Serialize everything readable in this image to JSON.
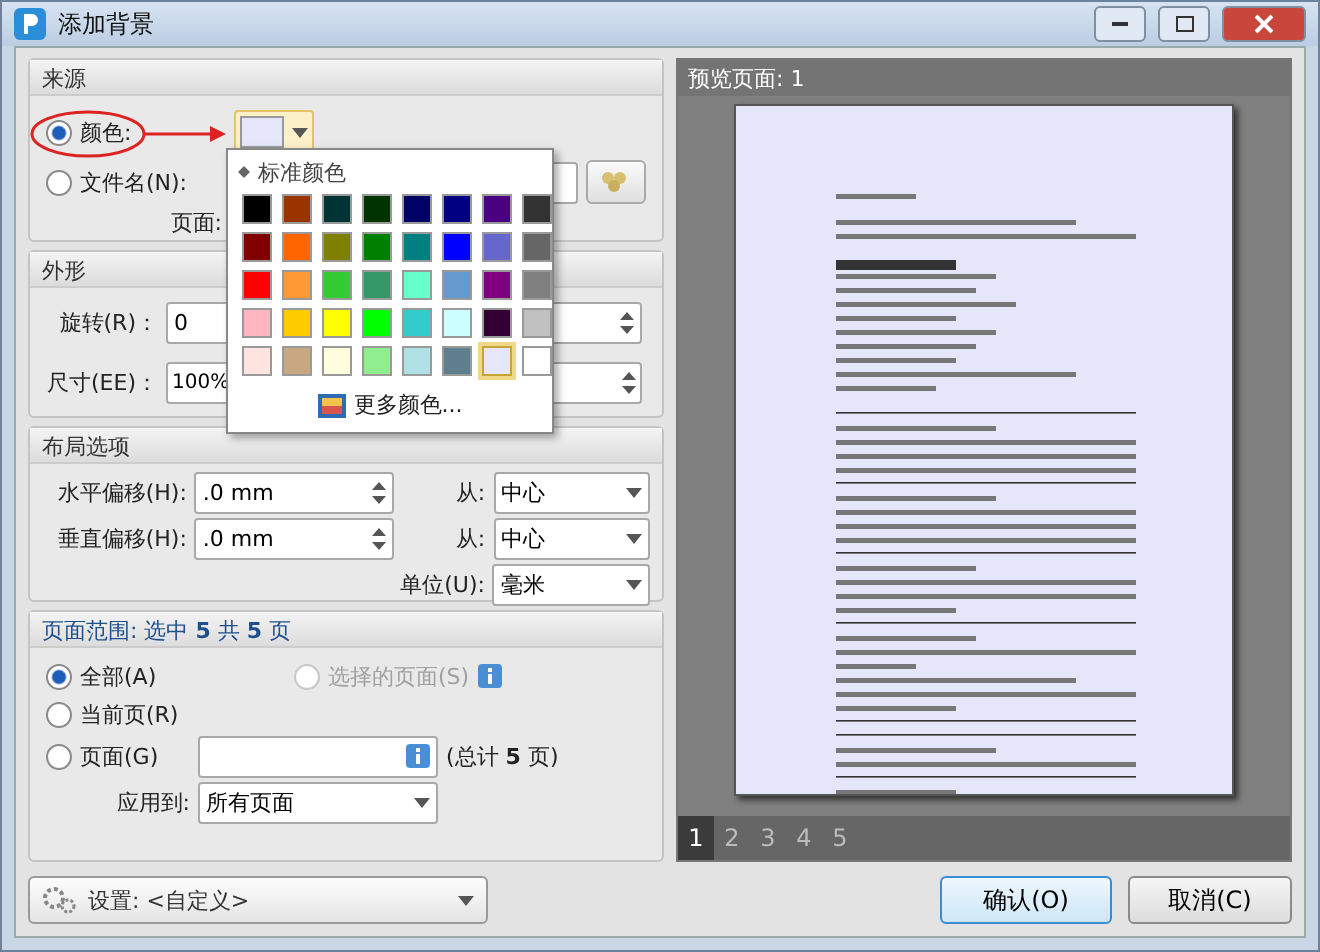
{
  "window": {
    "title": "添加背景"
  },
  "source": {
    "title": "来源",
    "options": [
      {
        "label": "颜色:",
        "selected": true
      },
      {
        "label": "文件名(N):",
        "selected": false
      }
    ],
    "color_button": {
      "color": "#e6e6fa"
    },
    "page_label": "页面:"
  },
  "color_popup": {
    "title": "标准颜色",
    "more": "更多颜色...",
    "swatches": [
      {
        "color": "#000000",
        "selected": false
      },
      {
        "color": "#993300",
        "selected": false
      },
      {
        "color": "#003333",
        "selected": false
      },
      {
        "color": "#003300",
        "selected": false
      },
      {
        "color": "#000066",
        "selected": false
      },
      {
        "color": "#000080",
        "selected": false
      },
      {
        "color": "#4b0082",
        "selected": false
      },
      {
        "color": "#333333",
        "selected": false
      },
      {
        "color": "#800000",
        "selected": false
      },
      {
        "color": "#ff6600",
        "selected": false
      },
      {
        "color": "#808000",
        "selected": false
      },
      {
        "color": "#008000",
        "selected": false
      },
      {
        "color": "#008080",
        "selected": false
      },
      {
        "color": "#0000ff",
        "selected": false
      },
      {
        "color": "#6666cc",
        "selected": false
      },
      {
        "color": "#666666",
        "selected": false
      },
      {
        "color": "#ff0000",
        "selected": false
      },
      {
        "color": "#ff9933",
        "selected": false
      },
      {
        "color": "#33cc33",
        "selected": false
      },
      {
        "color": "#339966",
        "selected": false
      },
      {
        "color": "#66ffcc",
        "selected": false
      },
      {
        "color": "#6699cc",
        "selected": false
      },
      {
        "color": "#800080",
        "selected": false
      },
      {
        "color": "#808080",
        "selected": false
      },
      {
        "color": "#ffb6c1",
        "selected": false
      },
      {
        "color": "#ffcc00",
        "selected": false
      },
      {
        "color": "#ffff00",
        "selected": false
      },
      {
        "color": "#00ff00",
        "selected": false
      },
      {
        "color": "#33cccc",
        "selected": false
      },
      {
        "color": "#ccffff",
        "selected": false
      },
      {
        "color": "#330033",
        "selected": false
      },
      {
        "color": "#c0c0c0",
        "selected": false
      },
      {
        "color": "#ffe4e1",
        "selected": false
      },
      {
        "color": "#c8a882",
        "selected": false
      },
      {
        "color": "#ffffe0",
        "selected": false
      },
      {
        "color": "#90ee90",
        "selected": false
      },
      {
        "color": "#b0e0e6",
        "selected": false
      },
      {
        "color": "#5f7f8f",
        "selected": false
      },
      {
        "color": "#e6e6fa",
        "selected": true
      },
      {
        "color": "#ffffff",
        "selected": false
      }
    ]
  },
  "shape": {
    "title": "外形",
    "rotation": {
      "label": "旋转(R)：",
      "value": "0"
    },
    "size": {
      "label": "尺寸(EE)：",
      "value": "100%"
    }
  },
  "layout": {
    "title": "布局选项",
    "rows": [
      {
        "label": "水平偏移(H):",
        "value": ".0 mm",
        "from_label": "从:",
        "from": "中心"
      },
      {
        "label": "垂直偏移(H):",
        "value": ".0 mm",
        "from_label": "从:",
        "from": "中心"
      }
    ],
    "unit": {
      "label": "单位(U):",
      "value": "毫米"
    }
  },
  "page_range": {
    "title": "页面范围: 选中 **5** 共 **5** 页",
    "options": [
      {
        "label": "全部(A)",
        "selected": true,
        "disabled": false
      },
      {
        "label": "选择的页面(S)",
        "selected": false,
        "disabled": true
      },
      {
        "label": "当前页(R)",
        "selected": false,
        "disabled": false
      },
      {
        "label": "页面(G)",
        "selected": false,
        "disabled": false
      }
    ],
    "total": "(总计 **5** 页)",
    "apply_label": "应用到:",
    "apply_value": "所有页面"
  },
  "preview": {
    "title": "预览页面: 1",
    "pages": [
      {
        "label": "1",
        "selected": true
      },
      {
        "label": "2",
        "selected": false
      },
      {
        "label": "3",
        "selected": false
      },
      {
        "label": "4",
        "selected": false
      },
      {
        "label": "5",
        "selected": false
      }
    ]
  },
  "settings": {
    "label": "设置:",
    "value": "<自定义>"
  },
  "buttons": [
    {
      "label": "确认(O)",
      "default": true
    },
    {
      "label": "取消(C)",
      "default": false
    }
  ]
}
